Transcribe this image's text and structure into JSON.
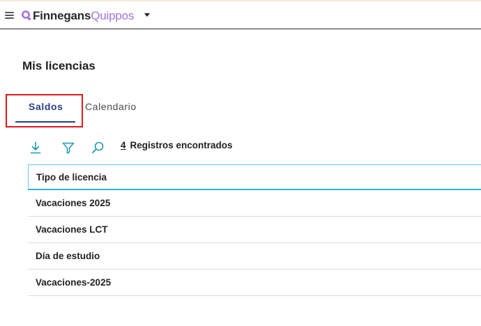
{
  "header": {
    "brand_primary": "Finnegans",
    "brand_secondary": "Quippos",
    "brand_color": "#a173d9",
    "menu_icon": "hamburger-icon",
    "dropdown_icon": "caret-down-icon"
  },
  "page": {
    "title": "Mis licencias"
  },
  "tabs": [
    {
      "label": "Saldos",
      "active": true
    },
    {
      "label": "Calendario",
      "active": false
    }
  ],
  "toolbar": {
    "icons": [
      "download-icon",
      "filter-icon",
      "search-icon"
    ],
    "records_count": "4",
    "records_label": "Registros encontrados",
    "accent_color": "#1a9bb5"
  },
  "table": {
    "columns": [
      "Tipo de licencia"
    ],
    "rows": [
      {
        "tipo": "Vacaciones 2025"
      },
      {
        "tipo": "Vacaciones LCT"
      },
      {
        "tipo": "Día de estudio"
      },
      {
        "tipo": "Vacaciones-2025"
      }
    ]
  }
}
